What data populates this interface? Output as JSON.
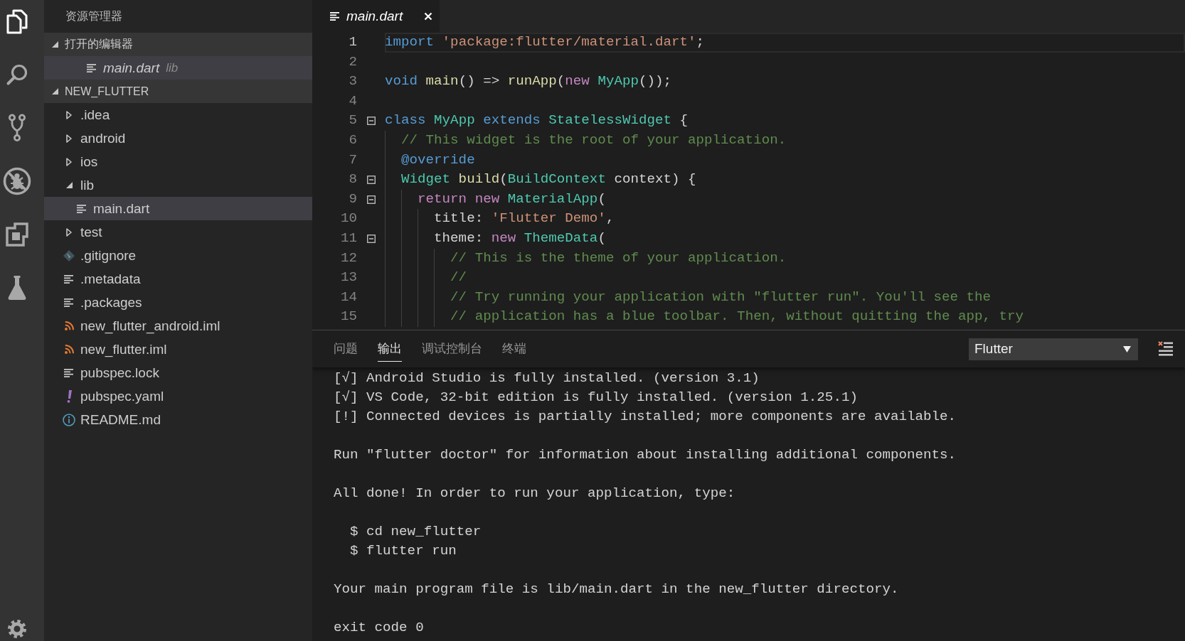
{
  "activity_bar": {
    "items": [
      {
        "kind": "explorer",
        "selected": true
      },
      {
        "kind": "search",
        "selected": false
      },
      {
        "kind": "scm",
        "selected": false
      },
      {
        "kind": "debug",
        "selected": false
      },
      {
        "kind": "extensions",
        "selected": false
      },
      {
        "kind": "test",
        "selected": false
      }
    ]
  },
  "explorer": {
    "title": "资源管理器",
    "sections": [
      {
        "kind": "editors",
        "title": "打开的编辑器",
        "expanded": true,
        "items": [
          {
            "label": "main.dart",
            "detail": "lib",
            "kind": "text",
            "preview": true,
            "selected": true
          }
        ]
      },
      {
        "kind": "tree",
        "title": "NEW_FLUTTER",
        "expanded": true,
        "items": [
          {
            "label": ".idea",
            "kind": "folder",
            "expanded": false,
            "selected": false
          },
          {
            "label": "android",
            "kind": "folder",
            "expanded": false,
            "selected": false
          },
          {
            "label": "ios",
            "kind": "folder",
            "expanded": false,
            "selected": false
          },
          {
            "label": "lib",
            "kind": "folder",
            "expanded": true,
            "selected": false,
            "children": [
              {
                "label": "main.dart",
                "kind": "text",
                "selected": true
              }
            ]
          },
          {
            "label": "test",
            "kind": "folder",
            "expanded": false,
            "selected": false
          },
          {
            "label": ".gitignore",
            "kind": "gitignore",
            "selected": false
          },
          {
            "label": ".metadata",
            "kind": "text",
            "selected": false
          },
          {
            "label": ".packages",
            "kind": "text",
            "selected": false
          },
          {
            "label": "new_flutter_android.iml",
            "kind": "iml",
            "selected": false
          },
          {
            "label": "new_flutter.iml",
            "kind": "iml",
            "selected": false
          },
          {
            "label": "pubspec.lock",
            "kind": "text",
            "selected": false
          },
          {
            "label": "pubspec.yaml",
            "kind": "yaml",
            "selected": false
          },
          {
            "label": "README.md",
            "kind": "markdown",
            "selected": false
          }
        ]
      }
    ]
  },
  "editor": {
    "tabs": [
      {
        "label": "main.dart",
        "preview": true,
        "selected": true
      }
    ],
    "lines": [
      {
        "number": "1",
        "foldable": false,
        "current": true,
        "tokens": [
          {
            "kind": "keyword",
            "text": "import"
          },
          {
            "kind": "string",
            "text": " 'package:flutter/material.dart'"
          },
          {
            "kind": "plain",
            "text": ";"
          }
        ]
      },
      {
        "number": "2",
        "foldable": false,
        "current": false
      },
      {
        "number": "3",
        "foldable": false,
        "current": false,
        "tokens": [
          {
            "kind": "keyword",
            "text": "void"
          },
          {
            "kind": "function",
            "text": " main"
          },
          {
            "kind": "plain",
            "text": "() => "
          },
          {
            "kind": "function",
            "text": "runApp"
          },
          {
            "kind": "plain",
            "text": "("
          },
          {
            "kind": "control",
            "text": "new"
          },
          {
            "kind": "type",
            "text": " MyApp"
          },
          {
            "kind": "plain",
            "text": "());"
          }
        ]
      },
      {
        "number": "4",
        "foldable": false,
        "current": false
      },
      {
        "number": "5",
        "foldable": true,
        "current": false,
        "tokens": [
          {
            "kind": "keyword",
            "text": "class"
          },
          {
            "kind": "type",
            "text": " MyApp"
          },
          {
            "kind": "keyword",
            "text": " extends"
          },
          {
            "kind": "type",
            "text": " StatelessWidget"
          },
          {
            "kind": "plain",
            "text": " {"
          }
        ]
      },
      {
        "number": "6",
        "foldable": false,
        "current": false,
        "tokens": [
          {
            "kind": "comment",
            "text": "  // This widget is the root of your application."
          }
        ]
      },
      {
        "number": "7",
        "foldable": false,
        "current": false,
        "tokens": [
          {
            "kind": "keyword",
            "text": "  @override"
          }
        ]
      },
      {
        "number": "8",
        "foldable": true,
        "current": false,
        "tokens": [
          {
            "kind": "type",
            "text": "  Widget"
          },
          {
            "kind": "function",
            "text": " build"
          },
          {
            "kind": "plain",
            "text": "("
          },
          {
            "kind": "type",
            "text": "BuildContext"
          },
          {
            "kind": "plain",
            "text": " context) {"
          }
        ]
      },
      {
        "number": "9",
        "foldable": true,
        "current": false,
        "tokens": [
          {
            "kind": "control",
            "text": "    return new"
          },
          {
            "kind": "type",
            "text": " MaterialApp"
          },
          {
            "kind": "plain",
            "text": "("
          }
        ]
      },
      {
        "number": "10",
        "foldable": false,
        "current": false,
        "tokens": [
          {
            "kind": "plain",
            "text": "      title: "
          },
          {
            "kind": "string",
            "text": "'Flutter Demo'"
          },
          {
            "kind": "plain",
            "text": ","
          }
        ]
      },
      {
        "number": "11",
        "foldable": true,
        "current": false,
        "tokens": [
          {
            "kind": "plain",
            "text": "      theme: "
          },
          {
            "kind": "control",
            "text": "new"
          },
          {
            "kind": "type",
            "text": " ThemeData"
          },
          {
            "kind": "plain",
            "text": "("
          }
        ]
      },
      {
        "number": "12",
        "foldable": false,
        "current": false,
        "tokens": [
          {
            "kind": "comment",
            "text": "        // This is the theme of your application."
          }
        ]
      },
      {
        "number": "13",
        "foldable": false,
        "current": false,
        "tokens": [
          {
            "kind": "comment",
            "text": "        //"
          }
        ]
      },
      {
        "number": "14",
        "foldable": false,
        "current": false,
        "tokens": [
          {
            "kind": "comment",
            "text": "        // Try running your application with \"flutter run\". You'll see the"
          }
        ]
      },
      {
        "number": "15",
        "foldable": false,
        "current": false,
        "tokens": [
          {
            "kind": "comment",
            "text": "        // application has a blue toolbar. Then, without quitting the app, try"
          }
        ]
      }
    ]
  },
  "panel": {
    "tabs": [
      {
        "label": "问题",
        "selected": false
      },
      {
        "label": "输出",
        "selected": true
      },
      {
        "label": "调试控制台",
        "selected": false
      },
      {
        "label": "终端",
        "selected": false
      }
    ],
    "channel": {
      "value": "Flutter"
    },
    "output": [
      {
        "lines": [
          "[√] Android Studio is fully installed. (version 3.1)",
          "[√] VS Code, 32-bit edition is fully installed. (version 1.25.1)",
          "[!] Connected devices is partially installed; more components are available."
        ]
      },
      {
        "lines": [
          "Run \"flutter doctor\" for information about installing additional components."
        ]
      },
      {
        "lines": [
          "All done! In order to run your application, type:"
        ]
      },
      {
        "lines": [
          "  $ cd new_flutter",
          "  $ flutter run"
        ]
      },
      {
        "lines": [
          "Your main program file is lib/main.dart in the new_flutter directory."
        ]
      },
      {
        "lines": [
          "exit code 0"
        ]
      }
    ]
  }
}
